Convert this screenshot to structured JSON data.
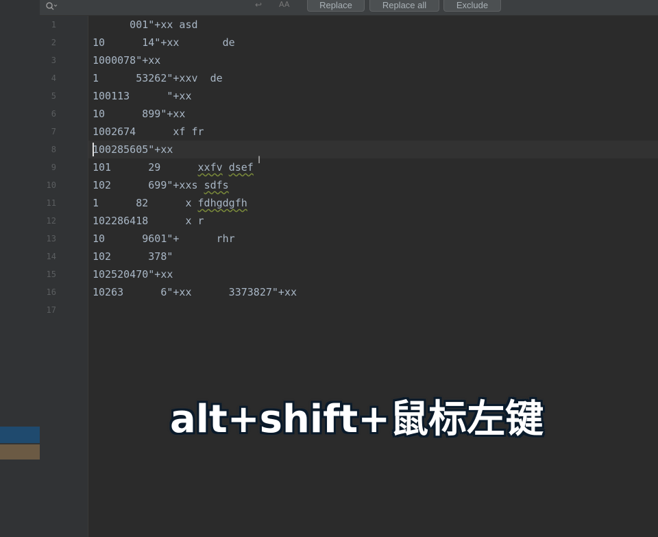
{
  "toolbar": {
    "search_icon": "search-icon",
    "newline_icon": "↩",
    "match_case_icon": "AA",
    "replace_label": "Replace",
    "replace_all_label": "Replace all",
    "exclude_label": "Exclude"
  },
  "editor": {
    "line_numbers": [
      "1",
      "2",
      "3",
      "4",
      "5",
      "6",
      "7",
      "8",
      "9",
      "10",
      "11",
      "12",
      "13",
      "14",
      "15",
      "16",
      "17"
    ],
    "current_line": 8,
    "lines": [
      {
        "segments": [
          {
            "text": "      001\"+xx asd"
          }
        ]
      },
      {
        "segments": [
          {
            "text": "10      14\"+xx       de"
          }
        ]
      },
      {
        "segments": [
          {
            "text": "1000078\"+xx"
          }
        ]
      },
      {
        "segments": [
          {
            "text": "1      53262\"+xxv  de"
          }
        ]
      },
      {
        "segments": [
          {
            "text": "100113      \"+xx"
          }
        ]
      },
      {
        "segments": [
          {
            "text": "10      899\"+xx"
          }
        ]
      },
      {
        "segments": [
          {
            "text": "1002674      xf fr"
          }
        ]
      },
      {
        "segments": [
          {
            "text": "100285605\"+xx"
          }
        ]
      },
      {
        "segments": [
          {
            "text": "101      29      "
          },
          {
            "text": "xxfv",
            "squiggle": true
          },
          {
            "text": " "
          },
          {
            "text": "dsef",
            "squiggle": true
          }
        ]
      },
      {
        "segments": [
          {
            "text": "102      699\"+xxs "
          },
          {
            "text": "sdfs",
            "squiggle": true
          }
        ]
      },
      {
        "segments": [
          {
            "text": "1      82      x "
          },
          {
            "text": "fdhgdgfh",
            "squiggle": true
          }
        ]
      },
      {
        "segments": [
          {
            "text": "102286418      x r"
          }
        ]
      },
      {
        "segments": [
          {
            "text": "10      9601\"+      rhr"
          }
        ]
      },
      {
        "segments": [
          {
            "text": "102      378\""
          }
        ]
      },
      {
        "segments": [
          {
            "text": "102520470\"+xx"
          }
        ]
      },
      {
        "segments": [
          {
            "text": "10263      6\"+xx      3373827\"+xx"
          }
        ]
      },
      {
        "segments": [
          {
            "text": ""
          }
        ]
      }
    ]
  },
  "subtitle": "alt+shift+鼠标左键",
  "colors": {
    "background": "#2b2b2b",
    "code_text": "#a9b7c6",
    "line_number": "#5b5e60",
    "selection_blue": "#1f4a6e",
    "selection_tan": "#6b5a44"
  }
}
